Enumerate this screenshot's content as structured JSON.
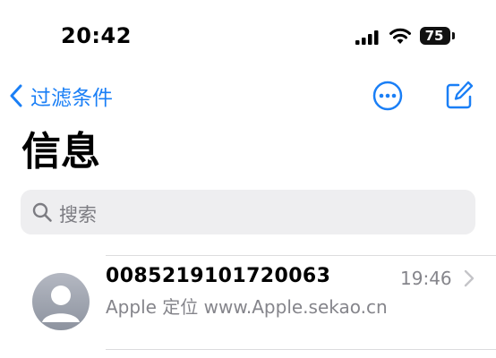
{
  "status_bar": {
    "time": "20:42",
    "battery": "75"
  },
  "nav": {
    "back_label": "过滤条件",
    "accent_color": "#1a7ff6"
  },
  "page": {
    "title": "信息"
  },
  "search": {
    "placeholder": "搜索"
  },
  "conversations": [
    {
      "sender": "0085219101720063",
      "preview": "Apple 定位  www.Apple.sekao.cn",
      "time": "19:46"
    }
  ],
  "icons": {
    "signal": "cellular-signal-icon",
    "wifi": "wifi-icon",
    "back": "chevron-left-icon",
    "more": "ellipsis-circle-icon",
    "compose": "compose-icon",
    "search": "search-icon",
    "avatar": "person-icon",
    "row": "chevron-right-icon"
  }
}
